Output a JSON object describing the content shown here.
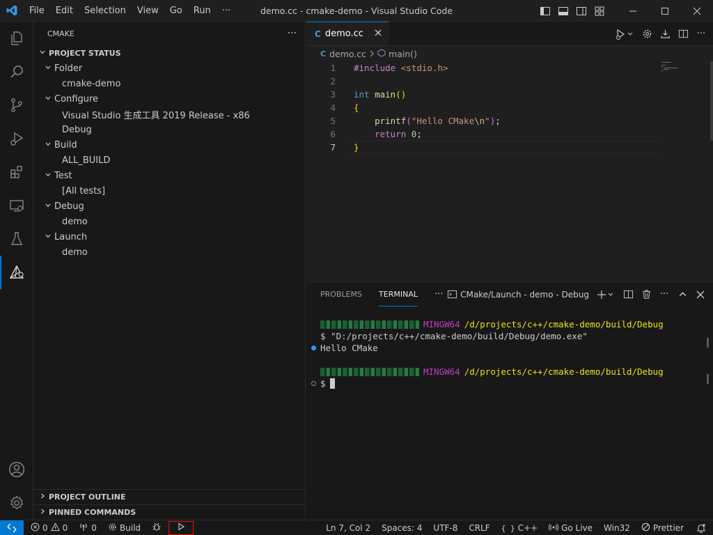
{
  "window": {
    "title": "demo.cc - cmake-demo - Visual Studio Code",
    "menu": [
      "File",
      "Edit",
      "Selection",
      "View",
      "Go",
      "Run",
      "···"
    ]
  },
  "activity_bar": {
    "items": [
      "explorer-icon",
      "search-icon",
      "source-control-icon",
      "run-debug-icon",
      "extensions-icon",
      "remote-explorer-icon",
      "testing-icon",
      "cmake-icon"
    ],
    "active": "cmake-icon",
    "bottom": [
      "accounts-icon",
      "manage-gear-icon"
    ]
  },
  "sidebar": {
    "header": "CMAKE",
    "more": "···",
    "project_status_title": "PROJECT STATUS",
    "groups": [
      {
        "label": "Folder",
        "value": "cmake-demo"
      },
      {
        "label": "Configure",
        "value": "Visual Studio 生成工具 2019 Release - x86",
        "value2": "Debug"
      },
      {
        "label": "Build",
        "value": "ALL_BUILD"
      },
      {
        "label": "Test",
        "value": "[All tests]"
      },
      {
        "label": "Debug",
        "value": "demo"
      },
      {
        "label": "Launch",
        "value": "demo"
      }
    ],
    "outline_title": "PROJECT OUTLINE",
    "pinned_title": "PINNED COMMANDS"
  },
  "editor": {
    "tab_label": "demo.cc",
    "breadcrumb": {
      "file": "demo.cc",
      "symbol": "main()"
    },
    "current_line": 7,
    "lines": [
      {
        "n": "1",
        "text": "#include <stdio.h>"
      },
      {
        "n": "2",
        "text": ""
      },
      {
        "n": "3",
        "text": "int main()"
      },
      {
        "n": "4",
        "text": "{"
      },
      {
        "n": "5",
        "text": "    printf(\"Hello CMake\\n\");"
      },
      {
        "n": "6",
        "text": "    return 0;"
      },
      {
        "n": "7",
        "text": "}"
      }
    ]
  },
  "panel": {
    "tabs": [
      "PROBLEMS",
      "TERMINAL",
      "···"
    ],
    "active_tab": "TERMINAL",
    "terminal_name": "CMake/Launch - demo - Debug",
    "terminal": {
      "host_label": "MINGW64",
      "path": "/d/projects/c++/cmake-demo/build/Debug",
      "command": "$ \"D:/projects/c++/cmake-demo/build/Debug/demo.exe\"",
      "output": "Hello CMake",
      "prompt": "$"
    }
  },
  "statusbar": {
    "errors": "0",
    "warnings": "0",
    "ports": "0",
    "build": "Build",
    "position": "Ln 7, Col 2",
    "spaces": "Spaces: 4",
    "encoding": "UTF-8",
    "eol": "CRLF",
    "language": "C++",
    "golive": "Go Live",
    "platform": "Win32",
    "prettier": "Prettier"
  },
  "colors": {
    "accent": "#0078d4",
    "highlight_box": "#e51400"
  }
}
